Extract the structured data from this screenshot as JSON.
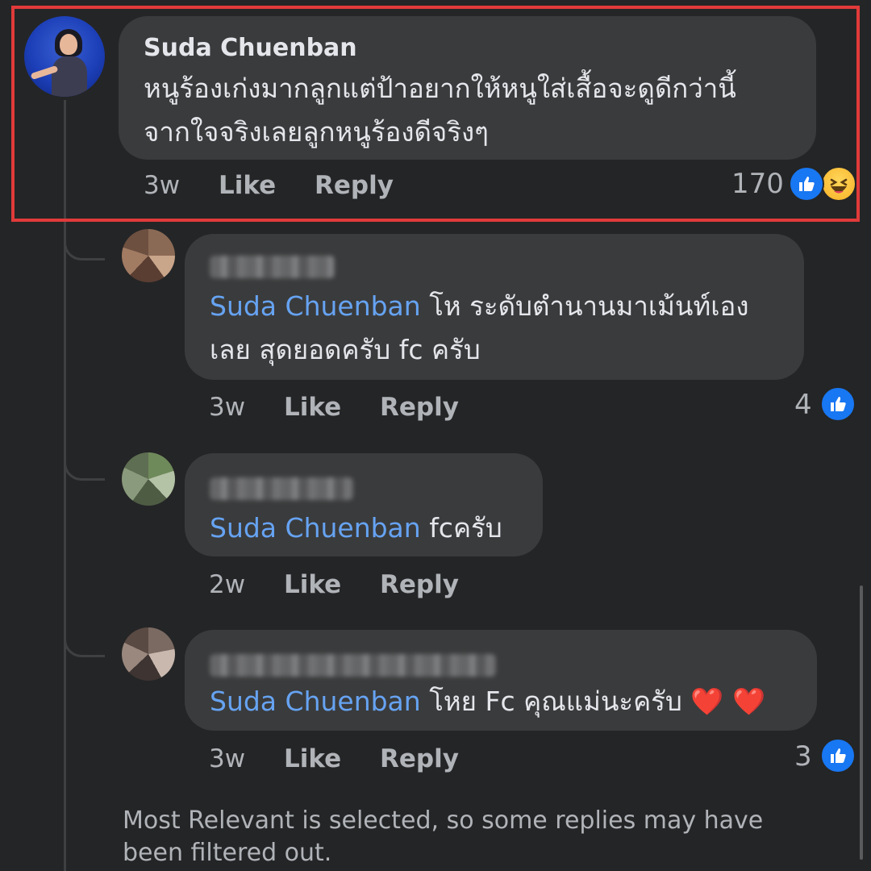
{
  "main_comment": {
    "author": "Suda Chuenban",
    "text_line1": "หนูร้องเก่งมากลูกแต่ป้าอยากให้หนูใส่เสื้อจะดูดีกว่านี้",
    "text_line2": "จากใจจริงเลยลูกหนูร้องดีจริงๆ",
    "time": "3w",
    "like_label": "Like",
    "reply_label": "Reply",
    "reaction_count": "170",
    "reactions": [
      "like-icon",
      "haha-icon"
    ]
  },
  "replies": [
    {
      "author": "(blurred)",
      "mention": "Suda Chuenban",
      "text_line1": " โห ระดับตำนานมาเม้นท์เอง",
      "text_line2": "เลย สุดยอดครับ fc ครับ",
      "time": "3w",
      "like_label": "Like",
      "reply_label": "Reply",
      "reaction_count": "4"
    },
    {
      "author": "(blurred)",
      "mention": "Suda Chuenban",
      "text_line1": " fcครับ",
      "time": "2w",
      "like_label": "Like",
      "reply_label": "Reply"
    },
    {
      "author": "(blurred)",
      "mention": "Suda Chuenban",
      "text_line1": " โหย Fc คุณแม่นะครับ",
      "emoji": "❤️ ❤️",
      "time": "3w",
      "like_label": "Like",
      "reply_label": "Reply",
      "reaction_count": "3"
    }
  ],
  "filter_notice": "Most Relevant is selected, so some replies may have been filtered out.",
  "colors": {
    "background": "#242526",
    "bubble": "#3a3b3c",
    "mention": "#66a3f2",
    "highlight_border": "#e03a3a",
    "like_blue": "#1877f2"
  }
}
